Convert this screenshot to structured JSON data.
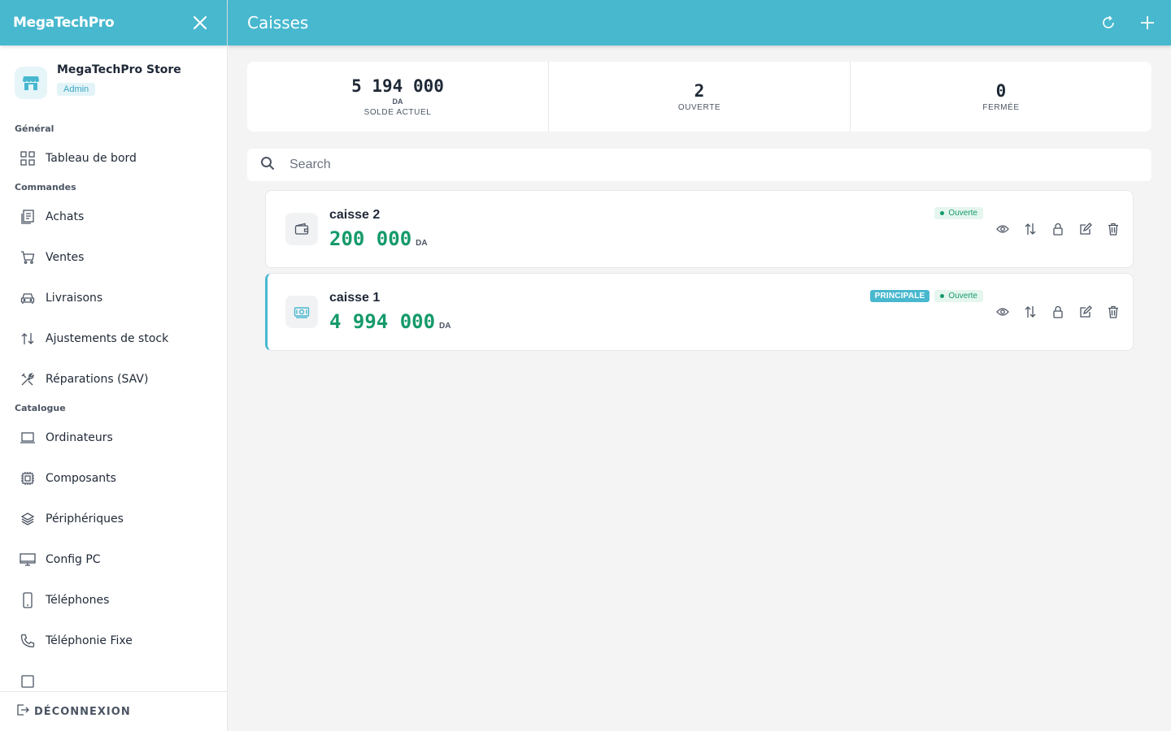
{
  "sidebar": {
    "brand": "MegaTechPro",
    "store_name": "MegaTechPro Store",
    "store_role": "Admin",
    "sections": [
      {
        "title": "Général",
        "items": [
          {
            "label": "Tableau de bord",
            "icon": "grid-icon"
          }
        ]
      },
      {
        "title": "Commandes",
        "items": [
          {
            "label": "Achats",
            "icon": "receipt-icon"
          },
          {
            "label": "Ventes",
            "icon": "cart-icon"
          },
          {
            "label": "Livraisons",
            "icon": "car-icon"
          },
          {
            "label": "Ajustements de stock",
            "icon": "arrows-updown-icon"
          },
          {
            "label": "Réparations (SAV)",
            "icon": "tools-icon"
          }
        ]
      },
      {
        "title": "Catalogue",
        "items": [
          {
            "label": "Ordinateurs",
            "icon": "laptop-icon"
          },
          {
            "label": "Composants",
            "icon": "chip-icon"
          },
          {
            "label": "Périphériques",
            "icon": "layers-icon"
          },
          {
            "label": "Config PC",
            "icon": "monitor-icon"
          },
          {
            "label": "Téléphones",
            "icon": "phone-icon"
          },
          {
            "label": "Téléphonie Fixe",
            "icon": "landline-icon"
          }
        ]
      }
    ],
    "logout_label": "DÉCONNEXION"
  },
  "header": {
    "title": "Caisses"
  },
  "stats": {
    "balance_value": "5 194 000",
    "balance_unit": "DA",
    "balance_label": "SOLDE ACTUEL",
    "open_value": "2",
    "open_label": "OUVERTE",
    "closed_value": "0",
    "closed_label": "FERMÉE"
  },
  "search": {
    "placeholder": "Search",
    "value": ""
  },
  "caisses": [
    {
      "name": "caisse 2",
      "amount": "200 000",
      "unit": "DA",
      "status": "Ouverte",
      "principal": false,
      "icon": "wallet-icon"
    },
    {
      "name": "caisse 1",
      "amount": "4 994 000",
      "unit": "DA",
      "status": "Ouverte",
      "principal": true,
      "principal_label": "PRINCIPALE",
      "icon": "cash-icon"
    }
  ],
  "colors": {
    "accent": "#48b8cf",
    "amount": "#159a6a",
    "status_open_bg": "#e5f6ee"
  }
}
